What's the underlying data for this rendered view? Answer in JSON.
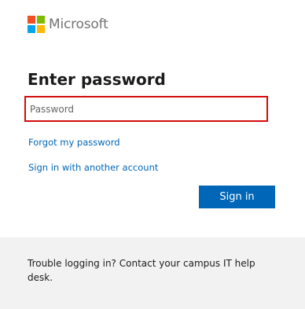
{
  "brand": {
    "name": "Microsoft",
    "logo_colors": [
      "#f25022",
      "#7fba00",
      "#00a4ef",
      "#ffb900"
    ]
  },
  "form": {
    "title": "Enter password",
    "password_placeholder": "Password",
    "password_value": ""
  },
  "links": {
    "forgot_password": "Forgot my password",
    "other_account": "Sign in with another account"
  },
  "actions": {
    "sign_in_label": "Sign in"
  },
  "footer": {
    "help_text": "Trouble logging in? Contact your campus IT help desk."
  },
  "colors": {
    "accent": "#0067b8",
    "input_border_error": "#d40b0b",
    "footer_bg": "#f2f2f2"
  }
}
